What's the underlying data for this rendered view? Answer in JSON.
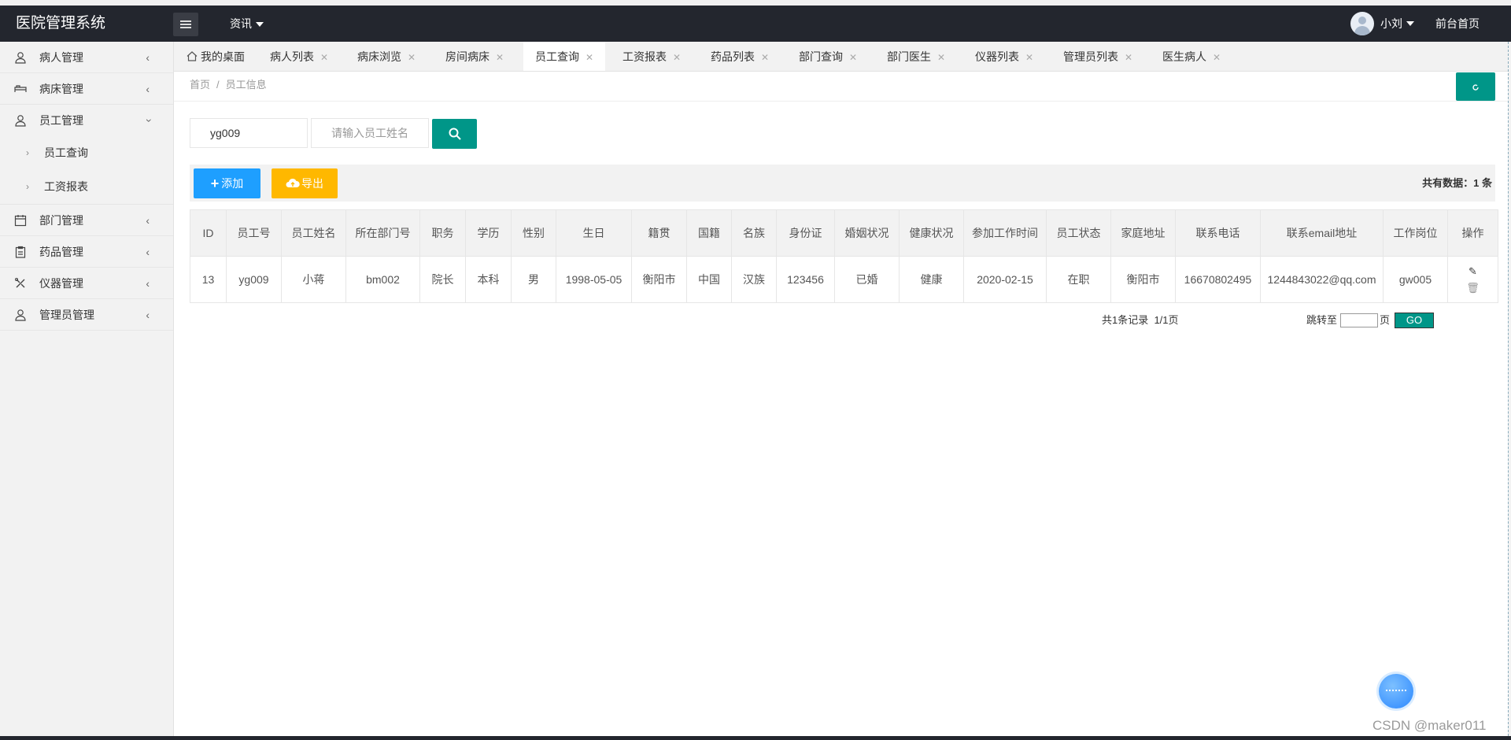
{
  "header": {
    "logo": "医院管理系统",
    "news_menu": "资讯",
    "username": "小刘",
    "front_link": "前台首页"
  },
  "sidebar": {
    "items": [
      {
        "label": "病人管理",
        "icon": "person-icon"
      },
      {
        "label": "病床管理",
        "icon": "bed-icon"
      },
      {
        "label": "员工管理",
        "icon": "person-icon",
        "expanded": true,
        "children": [
          {
            "label": "员工查询"
          },
          {
            "label": "工资报表"
          }
        ]
      },
      {
        "label": "部门管理",
        "icon": "calendar-icon"
      },
      {
        "label": "药品管理",
        "icon": "clipboard-icon"
      },
      {
        "label": "仪器管理",
        "icon": "tools-icon"
      },
      {
        "label": "管理员管理",
        "icon": "person-icon"
      }
    ]
  },
  "tabs": [
    {
      "label": "我的桌面",
      "closable": false
    },
    {
      "label": "病人列表",
      "closable": true
    },
    {
      "label": "病床浏览",
      "closable": true
    },
    {
      "label": "房间病床",
      "closable": true
    },
    {
      "label": "员工查询",
      "closable": true,
      "active": true
    },
    {
      "label": "工资报表",
      "closable": true
    },
    {
      "label": "药品列表",
      "closable": true
    },
    {
      "label": "部门查询",
      "closable": true
    },
    {
      "label": "部门医生",
      "closable": true
    },
    {
      "label": "仪器列表",
      "closable": true
    },
    {
      "label": "管理员列表",
      "closable": true
    },
    {
      "label": "医生病人",
      "closable": true
    }
  ],
  "breadcrumb": {
    "home": "首页",
    "sep": "/",
    "current": "员工信息"
  },
  "search": {
    "id_value": "yg009",
    "name_placeholder": "请输入员工姓名"
  },
  "toolbar": {
    "add_label": "添加",
    "export_label": "导出",
    "total_text": "共有数据：1 条"
  },
  "table": {
    "columns": [
      "ID",
      "员工号",
      "员工姓名",
      "所在部门号",
      "职务",
      "学历",
      "性别",
      "生日",
      "籍贯",
      "国籍",
      "名族",
      "身份证",
      "婚姻状况",
      "健康状况",
      "参加工作时间",
      "员工状态",
      "家庭地址",
      "联系电话",
      "联系email地址",
      "工作岗位",
      "操作"
    ],
    "rows": [
      [
        "13",
        "yg009",
        "小蒋",
        "bm002",
        "院长",
        "本科",
        "男",
        "1998-05-05",
        "衡阳市",
        "中国",
        "汉族",
        "123456",
        "已婚",
        "健康",
        "2020-02-15",
        "在职",
        "衡阳市",
        "16670802495",
        "1244843022@qq.com",
        "gw005"
      ]
    ]
  },
  "pager": {
    "summary": "共1条记录  1/1页",
    "jump_label": "跳转至",
    "page_unit": "页",
    "go_label": "GO"
  },
  "watermark": "CSDN @maker011",
  "colors": {
    "primary": "#009688",
    "blue": "#1e9fff",
    "yellow": "#ffb800",
    "header": "#23262e"
  }
}
